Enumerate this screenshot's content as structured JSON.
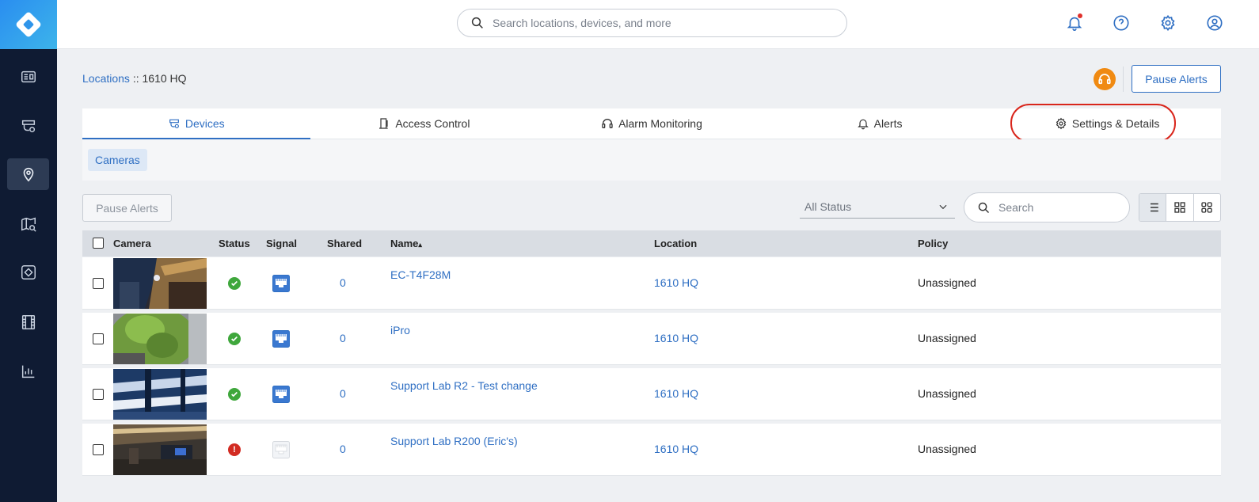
{
  "header": {
    "search_placeholder": "Search locations, devices, and more"
  },
  "breadcrumb": {
    "parent": "Locations",
    "separator": " :: ",
    "current": "1610 HQ"
  },
  "actions": {
    "pause_alerts_label": "Pause Alerts",
    "pause_alerts_secondary_label": "Pause Alerts"
  },
  "tabs": [
    {
      "label": "Devices",
      "icon": "devices-icon",
      "active": true
    },
    {
      "label": "Access Control",
      "icon": "door-icon",
      "active": false
    },
    {
      "label": "Alarm Monitoring",
      "icon": "headset-icon",
      "active": false
    },
    {
      "label": "Alerts",
      "icon": "bell-icon",
      "active": false
    },
    {
      "label": "Settings & Details",
      "icon": "gear-icon",
      "active": false
    }
  ],
  "filters": {
    "chip_label": "Cameras",
    "status_select_value": "All Status",
    "search_placeholder": "Search"
  },
  "table": {
    "headers": [
      "Camera",
      "Status",
      "Signal",
      "Shared",
      "Name",
      "Location",
      "Policy"
    ],
    "name_sort_indicator": "▴",
    "rows": [
      {
        "status": "ok",
        "signal": "connected",
        "shared": "0",
        "name": "EC-T4F28M",
        "location": "1610 HQ",
        "policy": "Unassigned"
      },
      {
        "status": "ok",
        "signal": "connected",
        "shared": "0",
        "name": "iPro",
        "location": "1610 HQ",
        "policy": "Unassigned"
      },
      {
        "status": "ok",
        "signal": "connected",
        "shared": "0",
        "name": "Support Lab R2 - Test change",
        "location": "1610 HQ",
        "policy": "Unassigned"
      },
      {
        "status": "error",
        "signal": "disconnected",
        "shared": "0",
        "name": "Support Lab R200 (Eric's)",
        "location": "1610 HQ",
        "policy": "Unassigned"
      }
    ]
  },
  "colors": {
    "accent": "#2f6fc3",
    "sidebar": "#0f1b33",
    "status_ok": "#3fa73c",
    "status_error": "#d22b22",
    "highlight": "#d9261c"
  }
}
